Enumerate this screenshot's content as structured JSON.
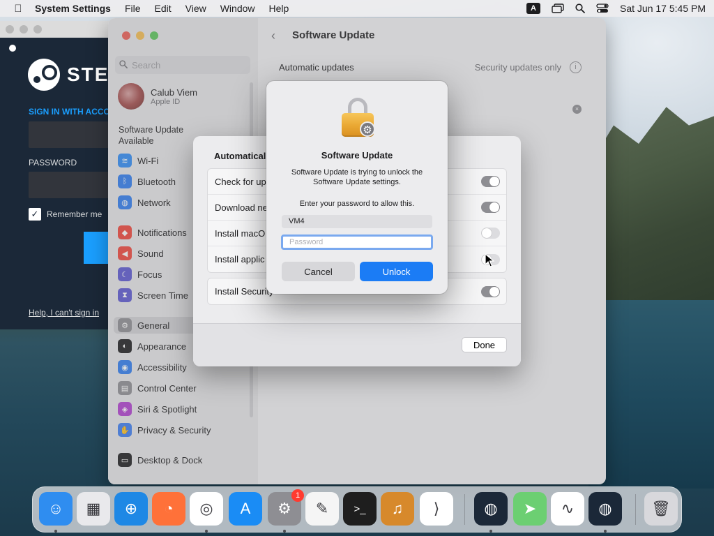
{
  "menubar": {
    "app_name": "System Settings",
    "menus": [
      "File",
      "Edit",
      "View",
      "Window",
      "Help"
    ],
    "input_source": "A",
    "clock": "Sat Jun 17  5:45 PM"
  },
  "steam": {
    "logo_text": "STEA",
    "sign_in_label": "SIGN IN WITH ACCO",
    "password_label": "PASSWORD",
    "remember_label": "Remember me",
    "help_link": "Help, I can't sign in"
  },
  "settings": {
    "search_placeholder": "Search",
    "account": {
      "name": "Calub Viem",
      "subtitle": "Apple ID"
    },
    "update_available": "Software Update Available",
    "sidebar_items": [
      {
        "label": "Wi-Fi",
        "color": "#2e8bf6",
        "glyph": "≋"
      },
      {
        "label": "Bluetooth",
        "color": "#2e7cf0",
        "glyph": "ᛒ"
      },
      {
        "label": "Network",
        "color": "#2e7cf0",
        "glyph": "◍"
      },
      {
        "label": "Notifications",
        "color": "#f0453b",
        "glyph": "◆"
      },
      {
        "label": "Sound",
        "color": "#f0453b",
        "glyph": "◀"
      },
      {
        "label": "Focus",
        "color": "#5b57d1",
        "glyph": "☾"
      },
      {
        "label": "Screen Time",
        "color": "#5b57d1",
        "glyph": "⧗"
      },
      {
        "label": "General",
        "color": "#8e8e93",
        "glyph": "⚙"
      },
      {
        "label": "Appearance",
        "color": "#1d1d1f",
        "glyph": "◐"
      },
      {
        "label": "Accessibility",
        "color": "#2e7cf0",
        "glyph": "◉"
      },
      {
        "label": "Control Center",
        "color": "#8e8e93",
        "glyph": "▤"
      },
      {
        "label": "Siri & Spotlight",
        "color": "#b03fd0",
        "glyph": "◈"
      },
      {
        "label": "Privacy & Security",
        "color": "#3c7df2",
        "glyph": "✋"
      },
      {
        "label": "Desktop & Dock",
        "color": "#1d1d1f",
        "glyph": "▭"
      }
    ],
    "page_title": "Software Update",
    "automatic_updates_label": "Automatic updates",
    "automatic_updates_value": "Security updates only"
  },
  "sheet": {
    "title": "Automatical",
    "rows": [
      {
        "label": "Check for up",
        "on": true
      },
      {
        "label": "Download ne",
        "on": true
      },
      {
        "label": "Install macO",
        "on": false
      },
      {
        "label": "Install applic",
        "on": false
      }
    ],
    "security_row": {
      "label": "Install Security",
      "on": true
    },
    "done_label": "Done"
  },
  "dialog": {
    "title": "Software Update",
    "message": "Software Update is trying to unlock the Software Update settings.",
    "prompt": "Enter your password to allow this.",
    "username": "VM4",
    "password_placeholder": "Password",
    "cancel_label": "Cancel",
    "unlock_label": "Unlock"
  },
  "dock": {
    "apps": [
      {
        "name": "finder",
        "color": "#2f8df0",
        "glyph": "☺",
        "running": true
      },
      {
        "name": "launchpad",
        "color": "#e9e9ec",
        "glyph": "▦",
        "running": false
      },
      {
        "name": "safari",
        "color": "#1e88e5",
        "glyph": "⊕",
        "running": false
      },
      {
        "name": "firefox",
        "color": "#ff7139",
        "glyph": "◔",
        "running": false
      },
      {
        "name": "chrome",
        "color": "#ffffff",
        "glyph": "◎",
        "running": true
      },
      {
        "name": "app-store",
        "color": "#1a8cf5",
        "glyph": "A",
        "running": false
      },
      {
        "name": "system-settings",
        "color": "#8e8e93",
        "glyph": "⚙",
        "running": true,
        "badge": "1"
      },
      {
        "name": "textedit",
        "color": "#f5f5f5",
        "glyph": "✎",
        "running": false
      },
      {
        "name": "terminal",
        "color": "#1e1e1e",
        "glyph": ">_",
        "running": false
      },
      {
        "name": "garageband",
        "color": "#d7892b",
        "glyph": "♫",
        "running": false
      },
      {
        "name": "vscode",
        "color": "#ffffff",
        "glyph": "⟩",
        "running": false
      },
      {
        "name": "steam",
        "color": "#1b2838",
        "glyph": "◍",
        "running": true
      },
      {
        "name": "maps",
        "color": "#6ccf72",
        "glyph": "➤",
        "running": false
      },
      {
        "name": "freeform",
        "color": "#ffffff",
        "glyph": "∿",
        "running": false
      },
      {
        "name": "steam-2",
        "color": "#1b2838",
        "glyph": "◍",
        "running": true
      },
      {
        "name": "trash",
        "color": "#d8d8dc",
        "glyph": "🗑",
        "running": false
      }
    ]
  }
}
